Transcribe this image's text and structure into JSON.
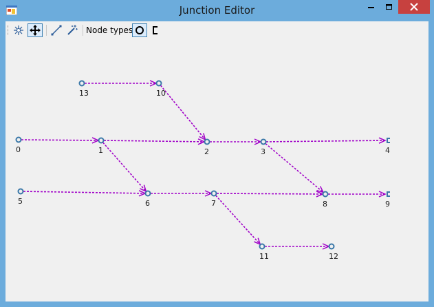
{
  "window": {
    "title": "Junction Editor",
    "controls": [
      "minimize",
      "maximize",
      "close"
    ]
  },
  "toolbar": {
    "buttons": [
      {
        "name": "select-tool",
        "icon": "starburst-icon"
      },
      {
        "name": "move-tool",
        "icon": "move-arrows-icon",
        "active": true
      },
      {
        "name": "connect-tool",
        "icon": "line-icon"
      },
      {
        "name": "magic-wand-tool",
        "icon": "magic-wand-icon"
      }
    ],
    "node_types_label": "Node types:",
    "node_type_buttons": [
      {
        "name": "junction-node-type",
        "icon": "circle-icon",
        "active": true
      },
      {
        "name": "terminal-node-type",
        "icon": "bracket-icon"
      }
    ]
  },
  "colors": {
    "edge": "#a000c8",
    "node": "#3a78a8",
    "close_button": "#c7413f"
  },
  "graph": {
    "nodes": [
      {
        "id": "13",
        "label": "13",
        "shape": "circle"
      },
      {
        "id": "10",
        "label": "10",
        "shape": "circle"
      },
      {
        "id": "0",
        "label": "0",
        "shape": "circle"
      },
      {
        "id": "1",
        "label": "1",
        "shape": "circle"
      },
      {
        "id": "2",
        "label": "2",
        "shape": "circle"
      },
      {
        "id": "3",
        "label": "3",
        "shape": "circle"
      },
      {
        "id": "4",
        "label": "4",
        "shape": "bracket"
      },
      {
        "id": "5",
        "label": "5",
        "shape": "circle"
      },
      {
        "id": "6",
        "label": "6",
        "shape": "circle"
      },
      {
        "id": "7",
        "label": "7",
        "shape": "circle"
      },
      {
        "id": "8",
        "label": "8",
        "shape": "circle"
      },
      {
        "id": "9",
        "label": "9",
        "shape": "bracket"
      },
      {
        "id": "11",
        "label": "11",
        "shape": "circle"
      },
      {
        "id": "12",
        "label": "12",
        "shape": "circle"
      }
    ],
    "edges": [
      {
        "from": "13",
        "to": "10"
      },
      {
        "from": "10",
        "to": "2"
      },
      {
        "from": "0",
        "to": "1"
      },
      {
        "from": "1",
        "to": "2"
      },
      {
        "from": "1",
        "to": "6"
      },
      {
        "from": "2",
        "to": "3"
      },
      {
        "from": "3",
        "to": "4"
      },
      {
        "from": "3",
        "to": "8"
      },
      {
        "from": "5",
        "to": "6"
      },
      {
        "from": "6",
        "to": "7"
      },
      {
        "from": "7",
        "to": "8"
      },
      {
        "from": "7",
        "to": "11"
      },
      {
        "from": "8",
        "to": "9"
      },
      {
        "from": "11",
        "to": "12"
      }
    ]
  }
}
